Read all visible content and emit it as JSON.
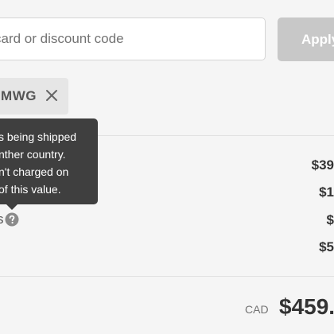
{
  "discount": {
    "placeholder": "card or discount code",
    "apply_label": "Apply",
    "applied_code": "DMWG"
  },
  "summary": {
    "rows": [
      {
        "value": "$39"
      },
      {
        "value": "$1"
      },
      {
        "value": "$"
      },
      {
        "value": "$5"
      }
    ],
    "taxes_label_fragment": "s",
    "info_tooltip": {
      "lines": [
        "s being shipped",
        "nther country.",
        "n't charged on",
        "of this value."
      ]
    }
  },
  "total": {
    "currency": "CAD",
    "amount": "$459."
  },
  "icons": {
    "remove": "close-icon",
    "info": "question-circle-icon"
  },
  "colors": {
    "background": "#f5f5f5",
    "apply_button": "#c8c8c8",
    "tooltip": "#3f3f3f",
    "tag": "#e6e6e6"
  }
}
